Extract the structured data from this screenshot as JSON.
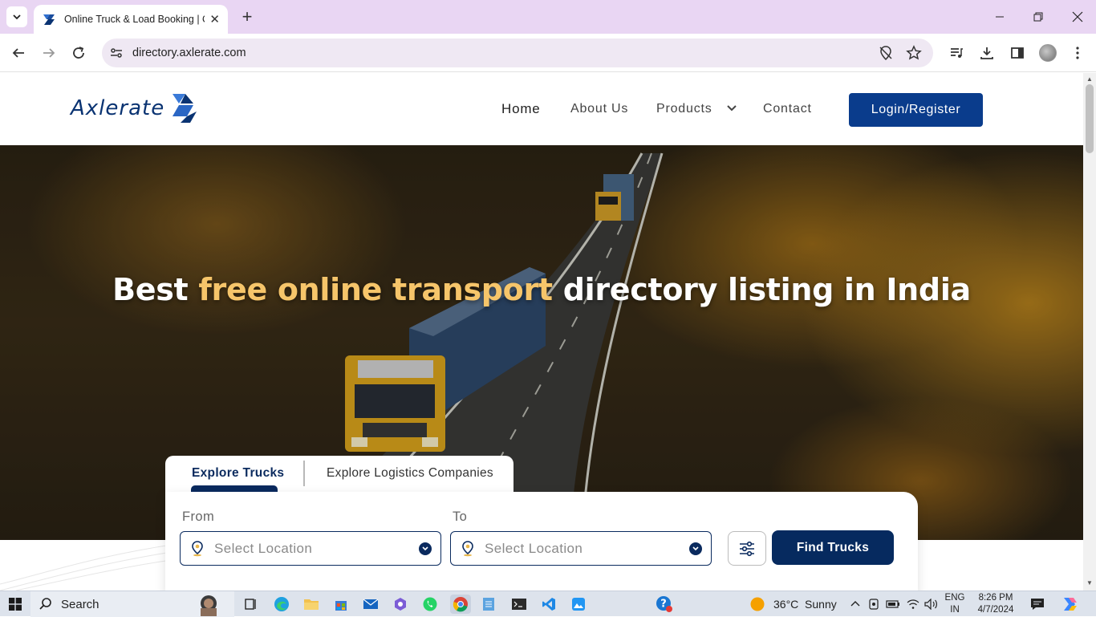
{
  "browser": {
    "tab_title": "Online Truck & Load Booking | Online Transport Directory",
    "url": "directory.axlerate.com"
  },
  "site": {
    "logo_text": "Axlerate",
    "nav": {
      "home": "Home",
      "about": "About Us",
      "products": "Products",
      "contact": "Contact"
    },
    "login_label": "Login/Register",
    "hero": {
      "title_part1": "Best ",
      "title_highlight": "free online transport",
      "title_part2": " directory listing in India"
    },
    "search": {
      "tab_trucks": "Explore Trucks",
      "tab_logistics": "Explore Logistics Companies",
      "from_label": "From",
      "to_label": "To",
      "from_placeholder": "Select Location",
      "to_placeholder": "Select Location",
      "find_label": "Find Trucks"
    }
  },
  "taskbar": {
    "search_label": "Search",
    "weather": "36°C  Sunny",
    "lang_line1": "ENG",
    "lang_line2": "IN",
    "time": "8:26 PM",
    "date": "4/7/2024"
  },
  "colors": {
    "brand_navy": "#0a2a5e",
    "login_blue": "#0a3c8c",
    "hero_highlight": "#f6c56a",
    "tabstrip": "#e9d6f3"
  }
}
